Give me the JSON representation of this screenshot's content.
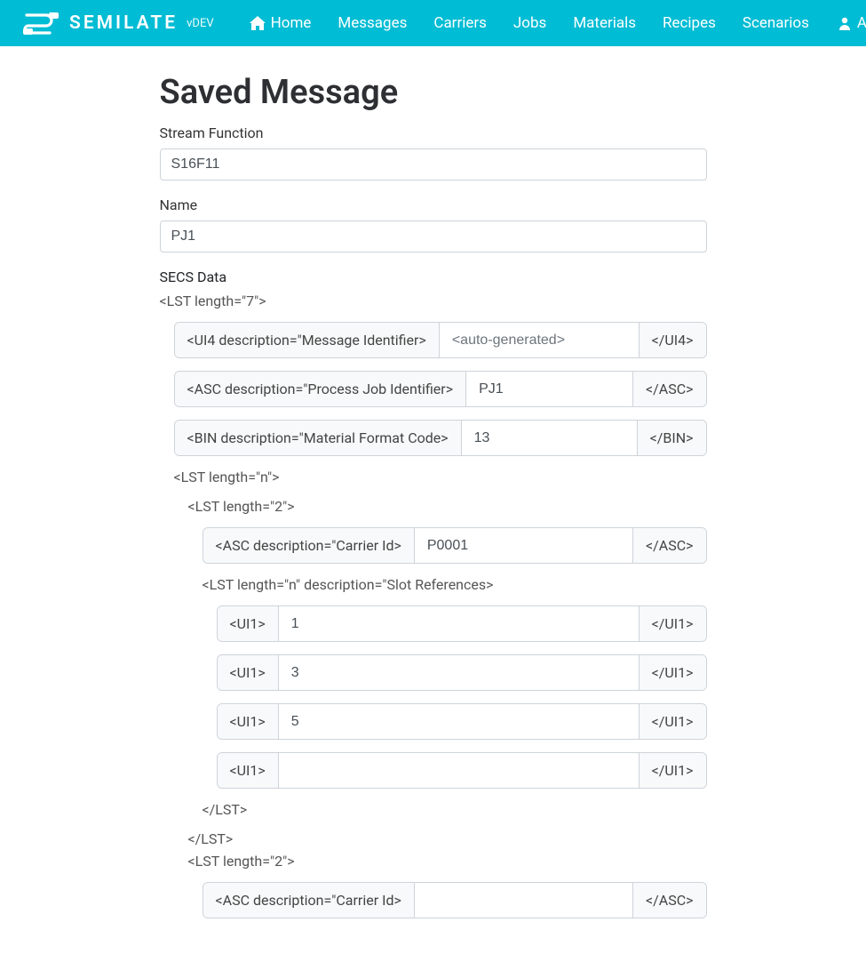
{
  "brand": {
    "name": "SEMILATE",
    "suffix": "vDEV"
  },
  "nav": {
    "home": "Home",
    "messages": "Messages",
    "carriers": "Carriers",
    "jobs": "Jobs",
    "materials": "Materials",
    "recipes": "Recipes",
    "scenarios": "Scenarios",
    "account": "Account"
  },
  "page": {
    "title": "Saved Message",
    "stream_function_label": "Stream Function",
    "stream_function_value": "S16F11",
    "name_label": "Name",
    "name_value": "PJ1",
    "secs_label": "SECS Data"
  },
  "secs": {
    "root_open": "<LST length=\"7\">",
    "rows": [
      {
        "open": "<UI4 description=\"Message Identifier>",
        "placeholder": "<auto-generated>",
        "value": "",
        "close": "</UI4>"
      },
      {
        "open": "<ASC description=\"Process Job Identifier>",
        "placeholder": "",
        "value": "PJ1",
        "close": "</ASC>"
      },
      {
        "open": "<BIN description=\"Material Format Code>",
        "placeholder": "",
        "value": "13",
        "close": "</BIN>"
      }
    ],
    "inner_list_open": "<LST length=\"n\">",
    "carrier1_open": "<LST length=\"2\">",
    "carrier1_id": {
      "open": "<ASC description=\"Carrier Id>",
      "value": "P0001",
      "close": "</ASC>"
    },
    "slot_refs_open": "<LST length=\"n\" description=\"Slot References>",
    "slots": [
      {
        "open": "<UI1>",
        "value": "1",
        "close": "</UI1>"
      },
      {
        "open": "<UI1>",
        "value": "3",
        "close": "</UI1>"
      },
      {
        "open": "<UI1>",
        "value": "5",
        "close": "</UI1>"
      },
      {
        "open": "<UI1>",
        "value": "",
        "close": "</UI1>"
      }
    ],
    "slot_refs_close": "</LST>",
    "carrier1_close": "</LST>",
    "carrier2_open": "<LST length=\"2\">",
    "carrier2_id": {
      "open": "<ASC description=\"Carrier Id>",
      "value": "",
      "close": "</ASC>"
    }
  }
}
